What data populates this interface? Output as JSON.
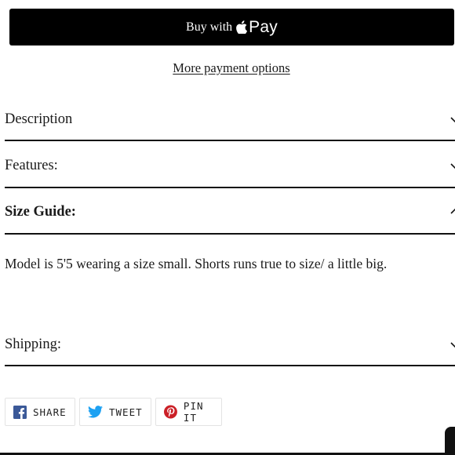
{
  "payment": {
    "buy_label": "Buy with",
    "pay_label": "Pay",
    "more_options": "More payment options"
  },
  "accordion": {
    "items": [
      {
        "label": "Description",
        "expanded": false
      },
      {
        "label": "Features:",
        "expanded": false
      },
      {
        "label": "Size Guide:",
        "expanded": true
      },
      {
        "label": "Shipping:",
        "expanded": false
      }
    ],
    "size_guide_text": "Model is 5'5 wearing a size small. Shorts runs true to size/ a little big."
  },
  "share": {
    "facebook_label": "SHARE",
    "twitter_label": "TWEET",
    "pinterest_label": "PIN IT"
  },
  "colors": {
    "facebook": "#3b5998",
    "twitter": "#1da1f2",
    "pinterest": "#cb2027"
  }
}
